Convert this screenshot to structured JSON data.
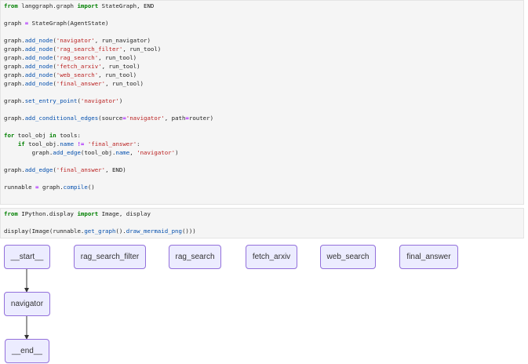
{
  "cell1": {
    "lines": [
      [
        {
          "t": "from",
          "c": "kw"
        },
        {
          "t": " langgraph.graph "
        },
        {
          "t": "import",
          "c": "kw"
        },
        {
          "t": " StateGraph, END"
        }
      ],
      [],
      [
        {
          "t": "graph "
        },
        {
          "t": "=",
          "c": "op"
        },
        {
          "t": " StateGraph(AgentState)"
        }
      ],
      [],
      [
        {
          "t": "graph."
        },
        {
          "t": "add_node",
          "c": "fn"
        },
        {
          "t": "("
        },
        {
          "t": "'navigator'",
          "c": "st"
        },
        {
          "t": ", run_navigator)"
        }
      ],
      [
        {
          "t": "graph."
        },
        {
          "t": "add_node",
          "c": "fn"
        },
        {
          "t": "("
        },
        {
          "t": "'rag_search_filter'",
          "c": "st"
        },
        {
          "t": ", run_tool)"
        }
      ],
      [
        {
          "t": "graph."
        },
        {
          "t": "add_node",
          "c": "fn"
        },
        {
          "t": "("
        },
        {
          "t": "'rag_search'",
          "c": "st"
        },
        {
          "t": ", run_tool)"
        }
      ],
      [
        {
          "t": "graph."
        },
        {
          "t": "add_node",
          "c": "fn"
        },
        {
          "t": "("
        },
        {
          "t": "'fetch_arxiv'",
          "c": "st"
        },
        {
          "t": ", run_tool)"
        }
      ],
      [
        {
          "t": "graph."
        },
        {
          "t": "add_node",
          "c": "fn"
        },
        {
          "t": "("
        },
        {
          "t": "'web_search'",
          "c": "st"
        },
        {
          "t": ", run_tool)"
        }
      ],
      [
        {
          "t": "graph."
        },
        {
          "t": "add_node",
          "c": "fn"
        },
        {
          "t": "("
        },
        {
          "t": "'final_answer'",
          "c": "st"
        },
        {
          "t": ", run_tool)"
        }
      ],
      [],
      [
        {
          "t": "graph."
        },
        {
          "t": "set_entry_point",
          "c": "fn"
        },
        {
          "t": "("
        },
        {
          "t": "'navigator'",
          "c": "st"
        },
        {
          "t": ")"
        }
      ],
      [],
      [
        {
          "t": "graph."
        },
        {
          "t": "add_conditional_edges",
          "c": "fn"
        },
        {
          "t": "(source"
        },
        {
          "t": "=",
          "c": "op"
        },
        {
          "t": "'navigator'",
          "c": "st"
        },
        {
          "t": ", path"
        },
        {
          "t": "=",
          "c": "op"
        },
        {
          "t": "router)"
        }
      ],
      [],
      [
        {
          "t": "for",
          "c": "kw"
        },
        {
          "t": " tool_obj "
        },
        {
          "t": "in",
          "c": "kw"
        },
        {
          "t": " tools:"
        }
      ],
      [
        {
          "t": "    "
        },
        {
          "t": "if",
          "c": "kw"
        },
        {
          "t": " tool_obj."
        },
        {
          "t": "name",
          "c": "fn"
        },
        {
          "t": " "
        },
        {
          "t": "!=",
          "c": "op"
        },
        {
          "t": " "
        },
        {
          "t": "'final_answer'",
          "c": "st"
        },
        {
          "t": ":"
        }
      ],
      [
        {
          "t": "        graph."
        },
        {
          "t": "add_edge",
          "c": "fn"
        },
        {
          "t": "(tool_obj."
        },
        {
          "t": "name",
          "c": "fn"
        },
        {
          "t": ", "
        },
        {
          "t": "'navigator'",
          "c": "st"
        },
        {
          "t": ")"
        }
      ],
      [],
      [
        {
          "t": "graph."
        },
        {
          "t": "add_edge",
          "c": "fn"
        },
        {
          "t": "("
        },
        {
          "t": "'final_answer'",
          "c": "st"
        },
        {
          "t": ", END)"
        }
      ],
      [],
      [
        {
          "t": "runnable "
        },
        {
          "t": "=",
          "c": "op"
        },
        {
          "t": " graph."
        },
        {
          "t": "compile",
          "c": "fn"
        },
        {
          "t": "()"
        }
      ]
    ]
  },
  "cell2": {
    "lines": [
      [
        {
          "t": "from",
          "c": "kw"
        },
        {
          "t": " IPython.display "
        },
        {
          "t": "import",
          "c": "kw"
        },
        {
          "t": " Image, display"
        }
      ],
      [],
      [
        {
          "t": "display(Image(runnable."
        },
        {
          "t": "get_graph",
          "c": "fn"
        },
        {
          "t": "()."
        },
        {
          "t": "draw_mermaid_png",
          "c": "fn"
        },
        {
          "t": "()))"
        }
      ]
    ]
  },
  "diagram": {
    "nodes": {
      "start": "__start__",
      "rag_search_filter": "rag_search_filter",
      "rag_search": "rag_search",
      "fetch_arxiv": "fetch_arxiv",
      "web_search": "web_search",
      "final_answer": "final_answer",
      "navigator": "navigator",
      "end": "__end__"
    },
    "colors": {
      "node_fill": "#ececff",
      "node_border": "#9370db",
      "edge": "#333333"
    }
  }
}
